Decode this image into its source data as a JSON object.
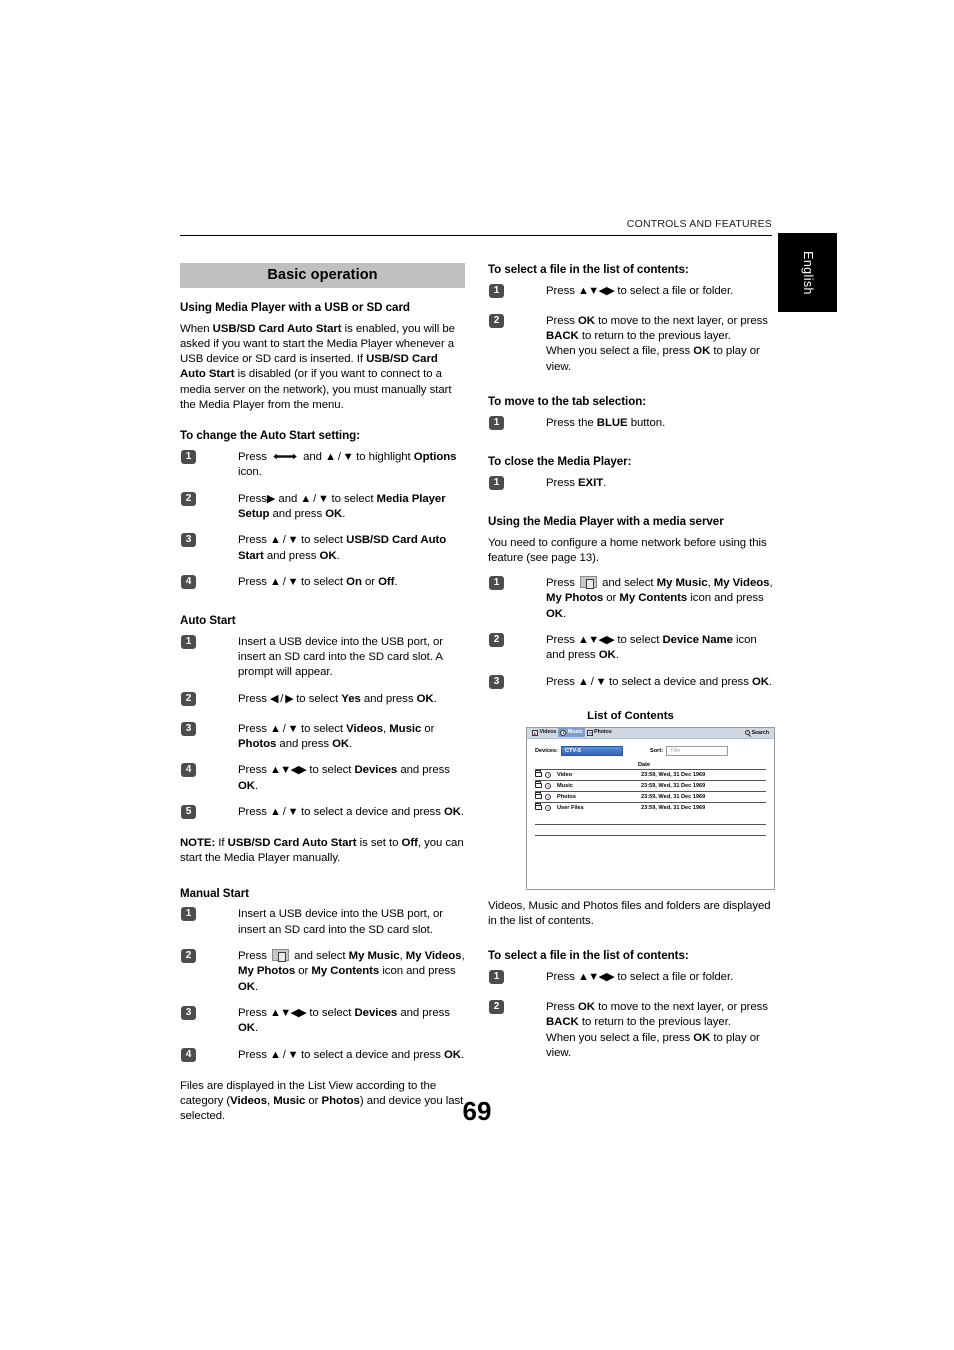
{
  "header": {
    "running_head": "CONTROLS AND FEATURES",
    "language_tab": "English"
  },
  "page_number": "69",
  "left_column": {
    "band_title": "Basic operation",
    "s1_heading": "Using Media Player with a USB or SD card",
    "s1_p1_a": "When ",
    "s1_p1_b1": "USB/SD Card Auto Start",
    "s1_p1_c": " is enabled, you will be asked if you want to start the Media Player whenever a USB device or SD card is inserted. If ",
    "s1_p1_b2": "USB/SD Card Auto Start",
    "s1_p1_d": " is disabled (or if you want to connect to a media server on the network), you must manually start the Media Player from the menu.",
    "s2_heading": "To change the Auto Start setting:",
    "s2_steps": [
      {
        "num": "1",
        "pre": "Press ",
        "icon": "wrench-icon",
        "mid": " and ",
        "arrows": "▲ / ▼",
        "post": " to highlight ",
        "bold": "Options",
        "tail": " icon."
      },
      {
        "num": "2",
        "pre": "Press",
        "arrows": "▶",
        "mid": " and ",
        "arrows2": "▲ / ▼",
        "post": " to select ",
        "bold": "Media Player Setup",
        "tail": " and press ",
        "bold2": "OK",
        "tail2": "."
      },
      {
        "num": "3",
        "pre": "Press ",
        "arrows": "▲ / ▼",
        "post": " to select ",
        "bold": "USB/SD Card Auto Start",
        "tail": " and press ",
        "bold2": "OK",
        "tail2": "."
      },
      {
        "num": "4",
        "pre": "Press ",
        "arrows": "▲ / ▼",
        "post": " to select ",
        "bold": "On",
        "tail": " or ",
        "bold2": "Off",
        "tail2": "."
      }
    ],
    "s3_heading": "Auto Start",
    "s3_steps": [
      {
        "num": "1",
        "text": "Insert a USB device into the USB port, or insert an SD card into the SD card slot. A prompt will appear."
      },
      {
        "num": "2",
        "pre": "Press ",
        "arrows": "◀ / ▶",
        "post": " to select ",
        "bold": "Yes",
        "tail": " and press ",
        "bold2": "OK",
        "tail2": "."
      },
      {
        "num": "3",
        "pre": "Press ",
        "arrows": "▲ / ▼",
        "post": " to select ",
        "bold": "Videos",
        "sep": ", ",
        "bold2": "Music",
        "sep2": " or ",
        "bold3": "Photos",
        "tail": " and press ",
        "bold4": "OK",
        "tail2": "."
      },
      {
        "num": "4",
        "pre": "Press ",
        "arrows": "▲▼◀▶",
        "post": " to select ",
        "bold": "Devices",
        "tail": " and press ",
        "bold2": "OK",
        "tail2": "."
      },
      {
        "num": "5",
        "pre": "Press ",
        "arrows": "▲ / ▼",
        "post": " to select a device and press ",
        "bold": "OK",
        "tail": "."
      }
    ],
    "note_label": "NOTE:",
    "note_a": " If ",
    "note_b": "USB/SD Card Auto Start",
    "note_c": " is set to ",
    "note_d": "Off",
    "note_e": ", you can start the Media Player manually.",
    "s4_heading": "Manual Start",
    "s4_steps": [
      {
        "num": "1",
        "text": "Insert a USB device into the USB port, or insert an SD card into the SD card slot."
      },
      {
        "num": "2",
        "pre": "Press ",
        "icon": "remote-key-icon",
        "post": " and select ",
        "bold": "My Music",
        "sep": ", ",
        "bold2": "My Videos",
        "sep2": ", ",
        "bold3": "My Photos",
        "sep3": " or ",
        "bold4": "My Contents",
        "tail": " icon and press ",
        "bold5": "OK",
        "tail2": "."
      },
      {
        "num": "3",
        "pre": "Press ",
        "arrows": "▲▼◀▶",
        "post": " to select ",
        "bold": "Devices",
        "tail": " and press ",
        "bold2": "OK",
        "tail2": "."
      },
      {
        "num": "4",
        "pre": "Press ",
        "arrows": "▲ / ▼",
        "post": " to select a device and press ",
        "bold": "OK",
        "tail": "."
      }
    ],
    "closing_a": "Files are displayed in the List View according to the category (",
    "closing_b1": "Videos",
    "closing_sep1": ", ",
    "closing_b2": "Music",
    "closing_sep2": " or ",
    "closing_b3": "Photos",
    "closing_c": ") and device you last selected."
  },
  "right_column": {
    "s1_heading": "To select a file in the list of contents:",
    "s1_steps": [
      {
        "num": "1",
        "pre": "Press ",
        "arrows": "▲▼◀▶",
        "post": " to select a file or folder."
      },
      {
        "num": "2",
        "pre": "Press ",
        "bold": "OK",
        "mid": " to move to the next layer, or press ",
        "bold2": "BACK",
        "mid2": " to return to the previous layer.",
        "line3a": "When you select a file, press ",
        "bold3": "OK",
        "line3b": " to play or view."
      }
    ],
    "s2_heading": "To move to the tab selection:",
    "s2_step": {
      "num": "1",
      "pre": "Press the ",
      "bold": "BLUE",
      "post": " button."
    },
    "s3_heading": "To close the Media Player:",
    "s3_step": {
      "num": "1",
      "pre": "Press ",
      "bold": "EXIT",
      "post": "."
    },
    "s4_heading": "Using the Media Player with a media server",
    "s4_intro": "You need to configure a home network before using this feature (see page 13).",
    "s4_steps": [
      {
        "num": "1",
        "pre": "Press ",
        "icon": "remote-key-icon",
        "post": " and select ",
        "bold": "My Music",
        "sep": ", ",
        "bold2": "My Videos",
        "sep2": ", ",
        "bold3": "My Photos",
        "sep3": " or ",
        "bold4": "My Contents",
        "tail": " icon and press ",
        "bold5": "OK",
        "tail2": "."
      },
      {
        "num": "2",
        "pre": "Press ",
        "arrows": "▲▼◀▶",
        "post": " to select ",
        "bold": "Device Name",
        "tail": " icon and press ",
        "bold2": "OK",
        "tail2": "."
      },
      {
        "num": "3",
        "pre": "Press ",
        "arrows": "▲ / ▼",
        "post": " to select a device and press ",
        "bold": "OK",
        "tail": "."
      }
    ],
    "figure": {
      "title": "List of Contents",
      "tabs": [
        {
          "label": "Videos",
          "icon": "video-icon",
          "selected": false
        },
        {
          "label": "Music",
          "icon": "music-disc-icon",
          "selected": true
        },
        {
          "label": "Photos",
          "icon": "photo-icon",
          "selected": false
        }
      ],
      "search_label": "Search",
      "devices_label": "Devices:",
      "devices_value": "CTV-5",
      "sort_label": "Sort:",
      "sort_placeholder": "Title",
      "date_header": "Date",
      "rows": [
        {
          "name": "Video",
          "date": "23:59, Wed, 31 Dec 1969"
        },
        {
          "name": "Music",
          "date": "23:59, Wed, 31 Dec 1969"
        },
        {
          "name": "Photos",
          "date": "23:59, Wed, 31 Dec 1969"
        },
        {
          "name": "User Files",
          "date": "23:59, Wed, 31 Dec 1969"
        }
      ]
    },
    "fig_caption": "Videos, Music and Photos files and folders are displayed in the list of contents.",
    "s5_heading": "To select a file in the list of contents:",
    "s5_steps": [
      {
        "num": "1",
        "pre": "Press ",
        "arrows": "▲▼◀▶",
        "post": " to select a file or folder."
      },
      {
        "num": "2",
        "pre": "Press ",
        "bold": "OK",
        "mid": " to move to the next layer, or press ",
        "bold2": "BACK",
        "mid2": " to return to the previous layer.",
        "line3a": "When you select a file, press ",
        "bold3": "OK",
        "line3b": " to play or view."
      }
    ]
  }
}
